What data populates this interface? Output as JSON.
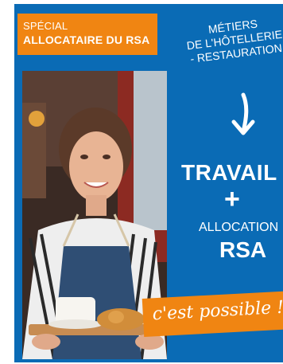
{
  "badge": {
    "line1": "SPÉCIAL",
    "line2": "ALLOCATAIRE DU RSA"
  },
  "jobs": {
    "line1": "MÉTIERS",
    "line2": "DE L'HÔTELLERIE",
    "line3": "- RESTAURATION"
  },
  "main": {
    "travail": "TRAVAIL",
    "plus": "+",
    "allocation": "ALLOCATION",
    "rsa": "RSA"
  },
  "slogan": "c'est possible !",
  "icons": {
    "arrow": "arrow-down-icon"
  },
  "colors": {
    "background_blue": "#0a6bb5",
    "accent_orange": "#f08512",
    "text_white": "#ffffff"
  }
}
